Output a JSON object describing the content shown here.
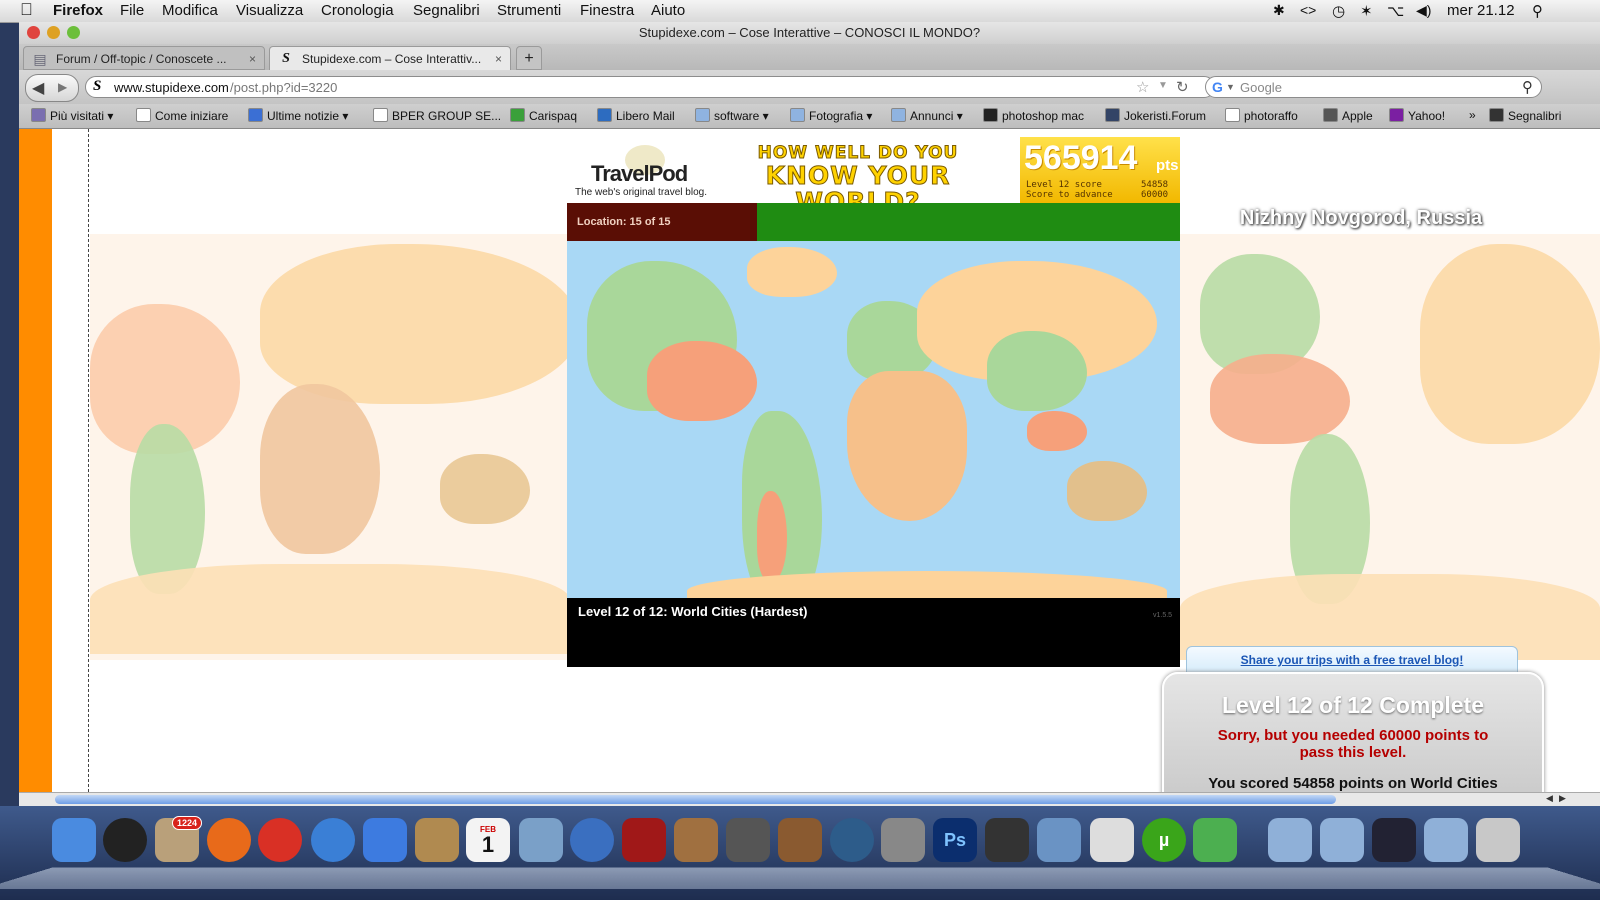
{
  "menubar": {
    "app": "Firefox",
    "items": [
      "File",
      "Modifica",
      "Visualizza",
      "Cronologia",
      "Segnalibri",
      "Strumenti",
      "Finestra",
      "Aiuto"
    ],
    "clock": "mer 21.12"
  },
  "window": {
    "title": "Stupidexe.com – Cose Interattive – CONOSCI IL MONDO?"
  },
  "tabs": [
    {
      "label": "Forum / Off-topic / Conoscete ...",
      "close": "×"
    },
    {
      "label": "Stupidexe.com – Cose Interattiv...",
      "close": "×"
    }
  ],
  "newtab": "+",
  "nav": {
    "url_host": "www.stupidexe.com",
    "url_path": "/post.php?id=3220",
    "search_placeholder": "Google"
  },
  "bookmarks": [
    {
      "label": "Più visitati ▾",
      "color": "#7a6fb0"
    },
    {
      "label": "Come iniziare",
      "color": "#ffffff"
    },
    {
      "label": "Ultime notizie ▾",
      "color": "#3b6fd4"
    },
    {
      "label": "BPER GROUP SE...",
      "color": "#ffffff"
    },
    {
      "label": "Carispaq",
      "color": "#3aa03a"
    },
    {
      "label": "Libero Mail",
      "color": "#2d6cc0"
    },
    {
      "label": "software ▾",
      "color": "#8fb3e0"
    },
    {
      "label": "Fotografia ▾",
      "color": "#8fb3e0"
    },
    {
      "label": "Annunci ▾",
      "color": "#8fb3e0"
    },
    {
      "label": "photoshop mac",
      "color": "#222222"
    },
    {
      "label": "Jokeristi.Forum",
      "color": "#334466"
    },
    {
      "label": "photoraffo",
      "color": "#ffffff"
    },
    {
      "label": "Apple",
      "color": "#555555"
    },
    {
      "label": "Yahoo!",
      "color": "#7b1fa2"
    },
    {
      "label": "»",
      "color": ""
    },
    {
      "label": "Segnalibri",
      "color": "#333333"
    }
  ],
  "game": {
    "logo": "TravelPod",
    "logo_tag": "The web's original travel blog.",
    "banner_line1": "HOW WELL DO YOU",
    "banner_line2": "KNOW YOUR WORLD?",
    "score": "565914",
    "score_unit": "pts",
    "level_score_label": "Level 12 score",
    "level_score_value": "54858",
    "advance_label": "Score to advance",
    "advance_value": "60000",
    "location": "Location: 15 of 15",
    "level_title": "Level 12 of 12: World Cities (Hardest)",
    "version": "v1.5.5"
  },
  "city_label": "Nizhny Novgorod, Russia",
  "result": {
    "share_link": "Share your trips with a free travel blog!",
    "title": "Level 12 of 12 Complete",
    "message": "Sorry, but you needed 60000 points to pass this level.",
    "scored": "You scored 54858 points on World Cities"
  },
  "dock_badge": "1224",
  "dock_calendar": {
    "month": "FEB",
    "day": "1"
  },
  "colors": {
    "orange_sidebar": "#ff8c00",
    "ocean": "#a9d8f5",
    "land_peach": "#fdd39a",
    "land_green": "#a9d79a",
    "land_salmon": "#f6a07a",
    "land_tan": "#e2c08c",
    "progress_green": "#1f8c12",
    "progress_dark": "#5a0e05",
    "score_yellow": "#f8c500"
  }
}
